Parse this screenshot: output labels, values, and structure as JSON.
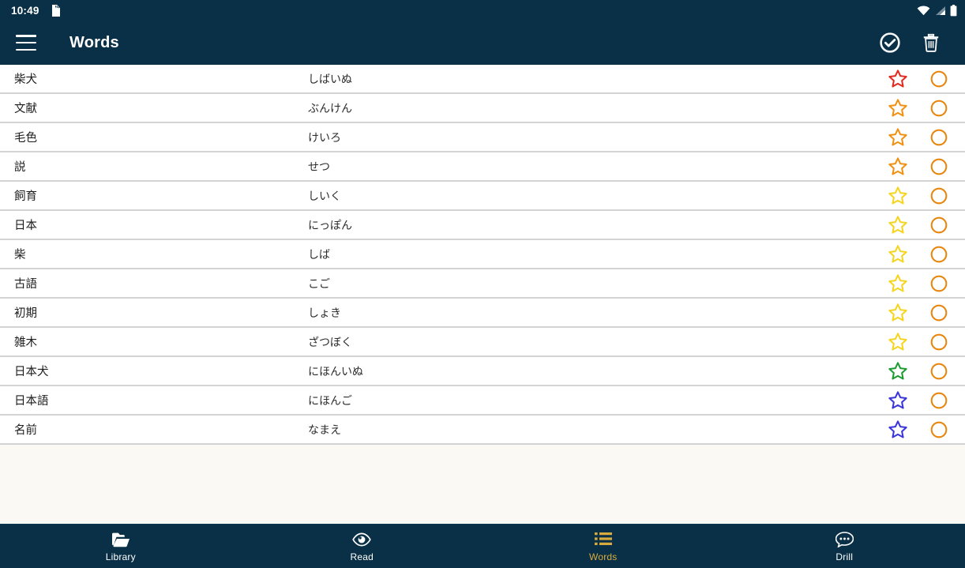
{
  "status_bar": {
    "time": "10:49",
    "notification_icon": "sd-card-icon",
    "right_icons": [
      "wifi-icon",
      "cellular-signal-icon",
      "battery-icon"
    ]
  },
  "app_bar": {
    "menu_icon": "hamburger-menu-icon",
    "title": "Words",
    "actions": [
      {
        "name": "check-circle-icon",
        "label": "Mark known"
      },
      {
        "name": "trash-icon",
        "label": "Delete"
      }
    ]
  },
  "colors": {
    "app_bar_bg": "#0a3047",
    "page_bg": "#fbf9f3",
    "list_divider": "#d3d3d3",
    "row_bg": "#ffffff",
    "accent_active": "#d9ab3c",
    "circle_orange": "#e8860e",
    "star_red": "#e02b20",
    "star_orange": "#ef9214",
    "star_yellow": "#f5d51f",
    "star_green": "#1f9b33",
    "star_blue": "#3a36d8"
  },
  "word_list": {
    "columns": [
      "term",
      "reading",
      "status-star",
      "status-circle"
    ],
    "rows": [
      {
        "term": "柴犬",
        "reading": "しばいぬ",
        "star_color": "#e02b20",
        "circle_color": "#e8860e"
      },
      {
        "term": "文献",
        "reading": "ぶんけん",
        "star_color": "#ef9214",
        "circle_color": "#e8860e"
      },
      {
        "term": "毛色",
        "reading": "けいろ",
        "star_color": "#ef9214",
        "circle_color": "#e8860e"
      },
      {
        "term": "説",
        "reading": "せつ",
        "star_color": "#ef9214",
        "circle_color": "#e8860e"
      },
      {
        "term": "飼育",
        "reading": "しいく",
        "star_color": "#f5d51f",
        "circle_color": "#e8860e"
      },
      {
        "term": "日本",
        "reading": "にっぽん",
        "star_color": "#f5d51f",
        "circle_color": "#e8860e"
      },
      {
        "term": "柴",
        "reading": "しば",
        "star_color": "#f5d51f",
        "circle_color": "#e8860e"
      },
      {
        "term": "古語",
        "reading": "こご",
        "star_color": "#f5d51f",
        "circle_color": "#e8860e"
      },
      {
        "term": "初期",
        "reading": "しょき",
        "star_color": "#f5d51f",
        "circle_color": "#e8860e"
      },
      {
        "term": "雑木",
        "reading": "ざつぼく",
        "star_color": "#f5d51f",
        "circle_color": "#e8860e"
      },
      {
        "term": "日本犬",
        "reading": "にほんいぬ",
        "star_color": "#1f9b33",
        "circle_color": "#e8860e"
      },
      {
        "term": "日本語",
        "reading": "にほんご",
        "star_color": "#3a36d8",
        "circle_color": "#e8860e"
      },
      {
        "term": "名前",
        "reading": "なまえ",
        "star_color": "#3a36d8",
        "circle_color": "#e8860e"
      }
    ]
  },
  "bottom_nav": {
    "items": [
      {
        "label": "Library",
        "icon": "folder-open-icon",
        "active": false
      },
      {
        "label": "Read",
        "icon": "eye-icon",
        "active": false
      },
      {
        "label": "Words",
        "icon": "list-icon",
        "active": true
      },
      {
        "label": "Drill",
        "icon": "speech-bubble-icon",
        "active": false
      }
    ]
  }
}
